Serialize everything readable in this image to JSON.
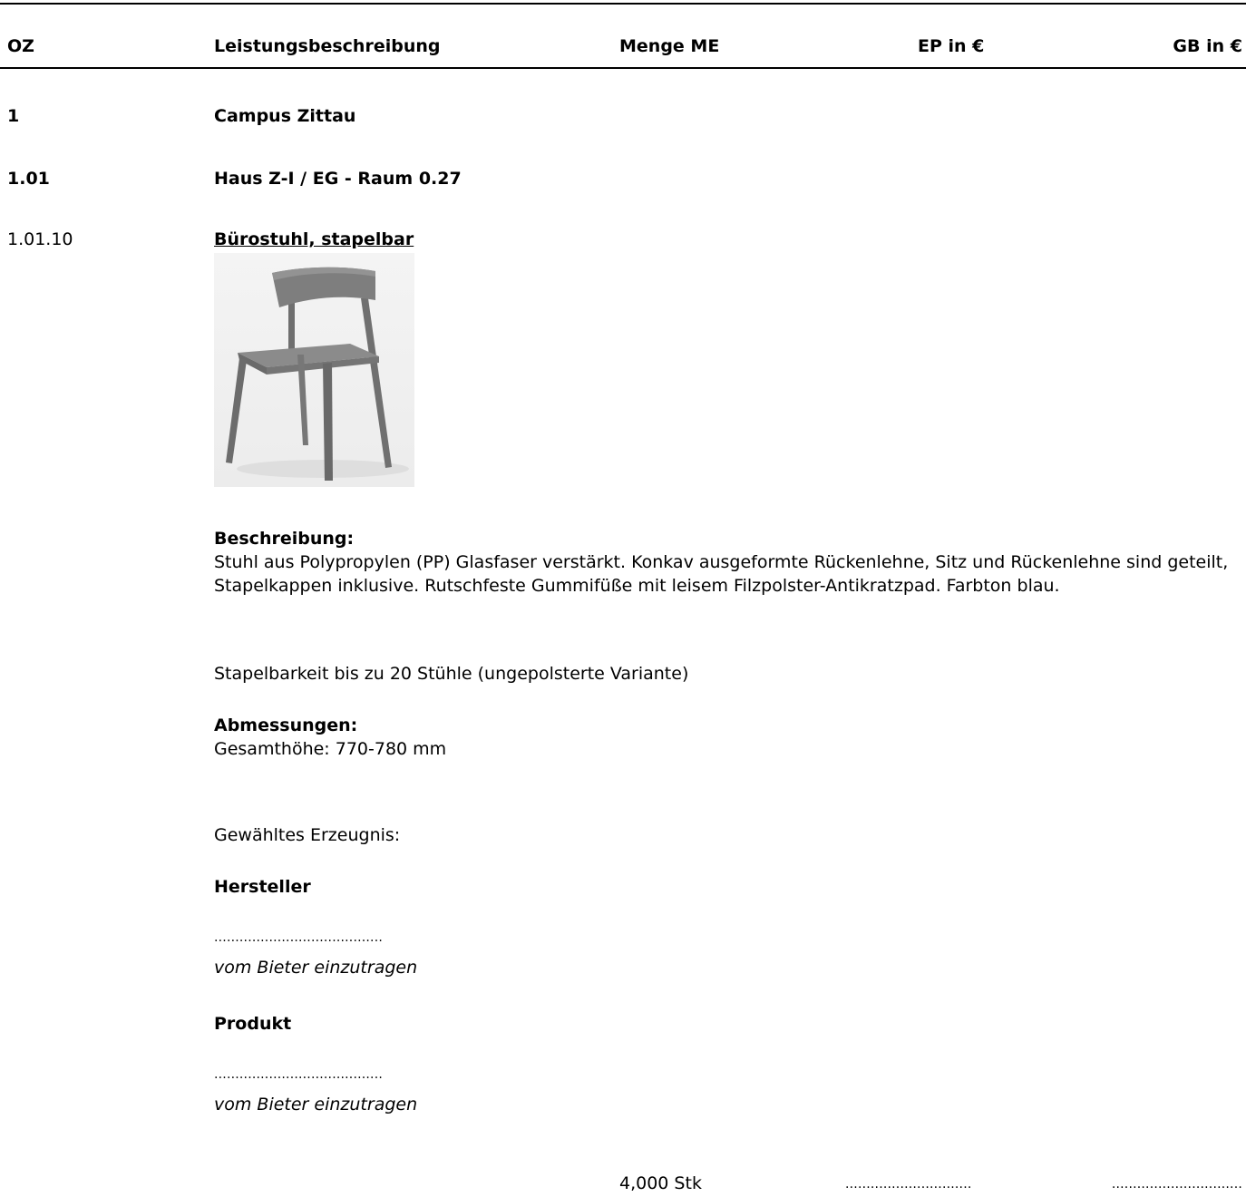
{
  "header": {
    "oz": "OZ",
    "description": "Leistungsbeschreibung",
    "quantity_unit": "Menge ME",
    "unit_price": "EP in €",
    "total_price": "GB in €"
  },
  "sections": [
    {
      "number": "1",
      "title": "Campus Zittau"
    },
    {
      "number": "1.01",
      "title": "Haus Z-I / EG - Raum 0.27"
    }
  ],
  "item": {
    "number": "1.01.10",
    "title": "Bürostuhl, stapelbar",
    "image_icon": "chair-photo",
    "description_heading": "Beschreibung:",
    "description_text": "Stuhl aus Polypropylen (PP) Glasfaser verstärkt. Konkav ausgeformte Rückenlehne, Sitz und Rückenlehne sind geteilt, Stapelkappen inklusive. Rutschfeste Gummifüße mit leisem Filzpolster-Antikratzpad. Farbton blau.",
    "stacking_note": "Stapelbarkeit bis zu 20 Stühle (ungepolsterte Variante)",
    "dimensions_heading": "Abmessungen:",
    "dimensions_text": "Gesamthöhe: 770-780 mm",
    "chosen_product_label": "Gewähltes Erzeugnis:",
    "manufacturer_label": "Hersteller",
    "manufacturer_blank": "........................................",
    "manufacturer_hint": "vom Bieter einzutragen",
    "product_label": "Produkt",
    "product_blank": "........................................",
    "product_hint": "vom Bieter einzutragen",
    "quantity": "4,000 Stk",
    "unit_price_blank": "..............................",
    "total_price_blank": "..............................."
  }
}
